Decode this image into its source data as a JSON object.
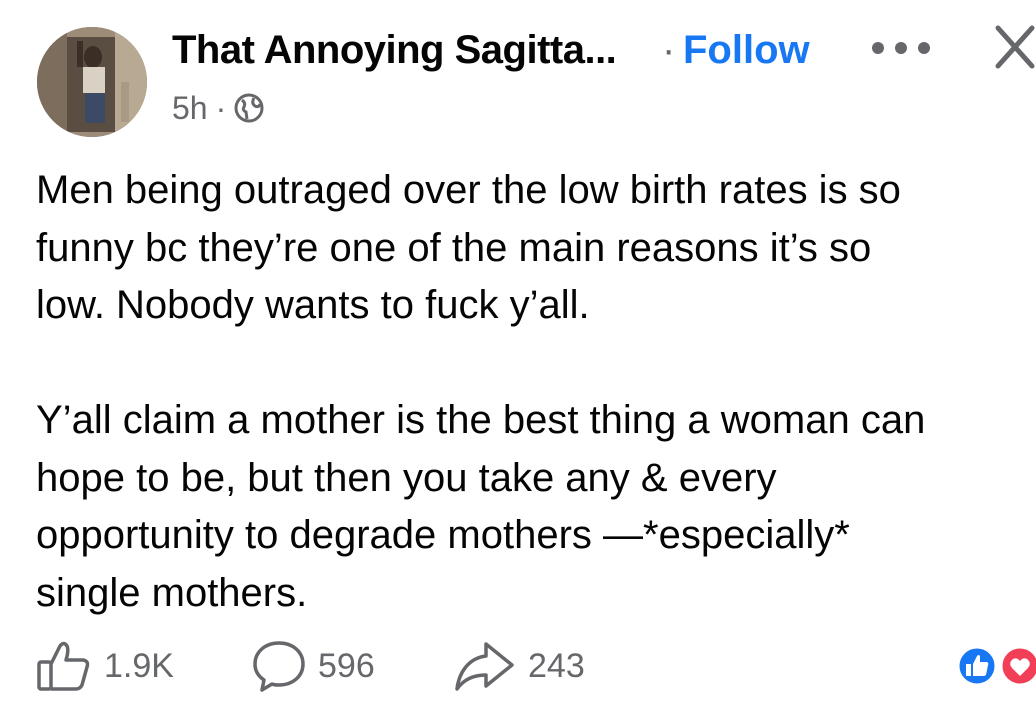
{
  "header": {
    "author_name": "That Annoying Sagitta...",
    "separator": "·",
    "follow_label": "Follow",
    "time": "5h",
    "meta_separator": "·",
    "privacy_icon": "globe-icon",
    "more_icon": "more-options-icon",
    "close_icon": "close-icon"
  },
  "post": {
    "text": "Men being outraged over the low birth rates is so\nfunny bc they’re one of the main reasons it’s so\nlow. Nobody wants to fuck y’all.\n\nY’all claim a mother is the best thing a woman can\nhope to be, but then you take any & every\nopportunity to degrade mothers —*especially*\nsingle mothers."
  },
  "actions": {
    "like_count": "1.9K",
    "comment_count": "596",
    "share_count": "243",
    "reaction_icons": [
      "like-reaction-icon",
      "love-reaction-icon"
    ]
  },
  "colors": {
    "accent": "#1877f2",
    "secondary_text": "#65676b",
    "primary_text": "#050505",
    "love": "#f33e58"
  }
}
